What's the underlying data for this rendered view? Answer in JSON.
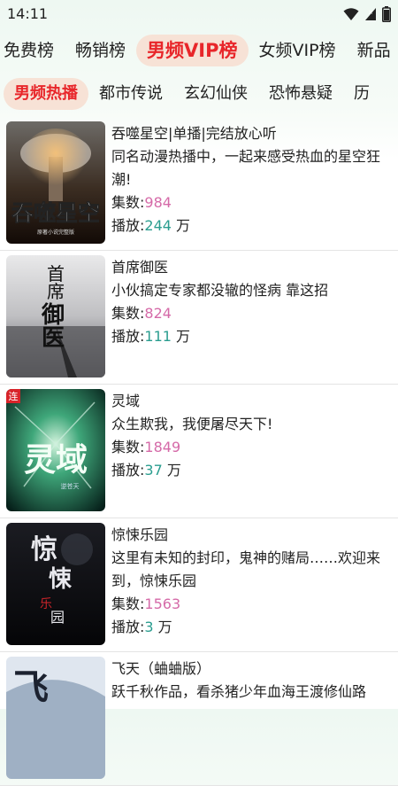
{
  "status": {
    "time": "14:11"
  },
  "tabs_primary": [
    "免费榜",
    "畅销榜",
    "男频VIP榜",
    "女频VIP榜",
    "新品"
  ],
  "tabs_secondary": [
    "男频热播",
    "都市传说",
    "玄幻仙侠",
    "恐怖悬疑",
    "历"
  ],
  "labels": {
    "episodes": "集数:",
    "plays": "播放:",
    "unit": " 万"
  },
  "books": [
    {
      "title": "吞噬星空|单播|完结放心听",
      "desc": "同名动漫热播中，一起来感受热血的星空狂潮!",
      "episodes": "984",
      "plays": "244",
      "cover_text": "吞噬星空",
      "cover_sub": "原著小说完整版"
    },
    {
      "title": "首席御医",
      "desc": "小伙搞定专家都没辙的怪病 靠这招",
      "episodes": "824",
      "plays": "111",
      "cover_text": "首席御医",
      "cover_sub": ""
    },
    {
      "title": "灵域",
      "desc": "众生欺我，我便屠尽天下!",
      "episodes": "1849",
      "plays": "37",
      "cover_text": "灵域",
      "cover_sub": "逆苍天",
      "cover_badge": "连"
    },
    {
      "title": "惊悚乐园",
      "desc": "这里有未知的封印，鬼神的赌局……欢迎来到，惊悚乐园",
      "episodes": "1563",
      "plays": "3",
      "cover_text": "惊悚乐园",
      "cover_sub": ""
    },
    {
      "title": "飞天（蛐蛐版）",
      "desc": "跃千秋作品，看杀猪少年血海王渡修仙路",
      "episodes": "",
      "plays": "",
      "cover_text": "飞",
      "cover_sub": ""
    }
  ]
}
